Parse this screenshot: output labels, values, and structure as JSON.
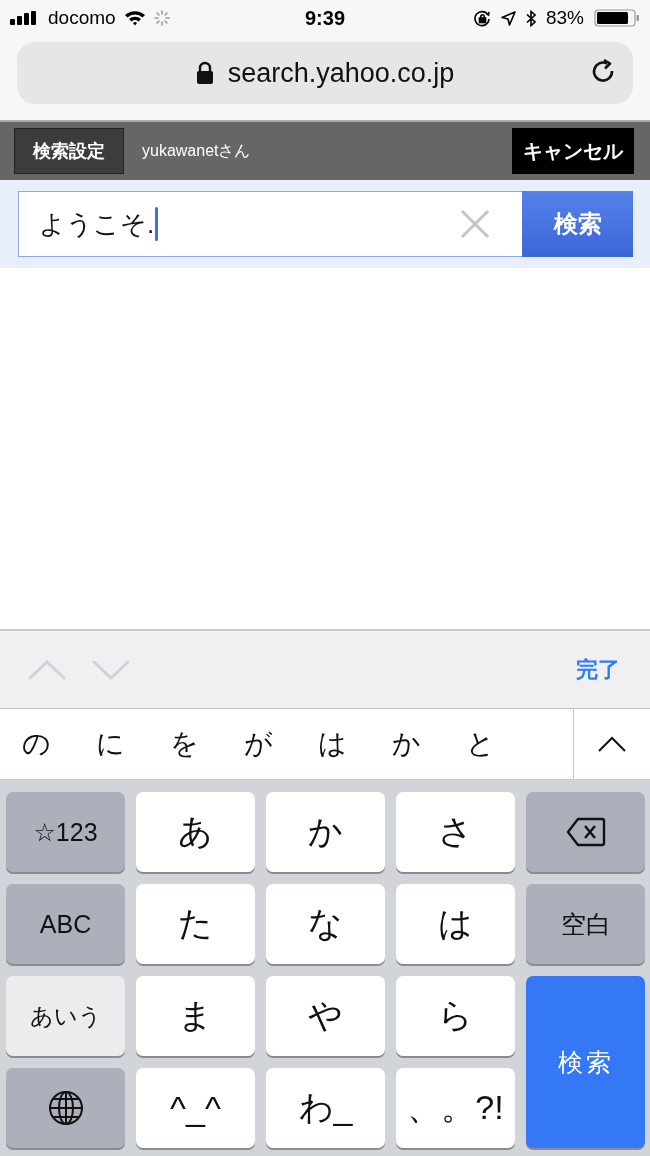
{
  "status_bar": {
    "carrier": "docomo",
    "time": "9:39",
    "battery_percent": "83%"
  },
  "address_bar": {
    "url": "search.yahoo.co.jp"
  },
  "header": {
    "settings_button": "検索設定",
    "user": "yukawanetさん",
    "cancel_button": "キャンセル"
  },
  "search": {
    "value": "ようこそ.",
    "button": "検索"
  },
  "toolbar": {
    "nav": [
      {
        "kind": "up",
        "disabled": true
      },
      {
        "kind": "down",
        "disabled": true
      }
    ],
    "done": "完了"
  },
  "candidates": [
    "の",
    "に",
    "を",
    "が",
    "は",
    "か",
    "と"
  ],
  "keys": [
    {
      "kind": "function",
      "label": "☆123"
    },
    {
      "kind": "letter",
      "label": "あ"
    },
    {
      "kind": "letter",
      "label": "か"
    },
    {
      "kind": "letter",
      "label": "さ"
    },
    {
      "kind": "delete"
    },
    {
      "kind": "function",
      "label": "ABC"
    },
    {
      "kind": "letter",
      "label": "た"
    },
    {
      "kind": "letter",
      "label": "な"
    },
    {
      "kind": "letter",
      "label": "は"
    },
    {
      "kind": "function",
      "label": "空白"
    },
    {
      "kind": "mode",
      "label": "あいう"
    },
    {
      "kind": "letter",
      "label": "ま"
    },
    {
      "kind": "letter",
      "label": "や"
    },
    {
      "kind": "letter",
      "label": "ら"
    },
    {
      "kind": "action",
      "label": "検索"
    },
    {
      "kind": "globe"
    },
    {
      "kind": "letter",
      "label": "^_^"
    },
    {
      "kind": "letter",
      "label": "わ_"
    },
    {
      "kind": "letter",
      "label": "、。?!"
    }
  ]
}
